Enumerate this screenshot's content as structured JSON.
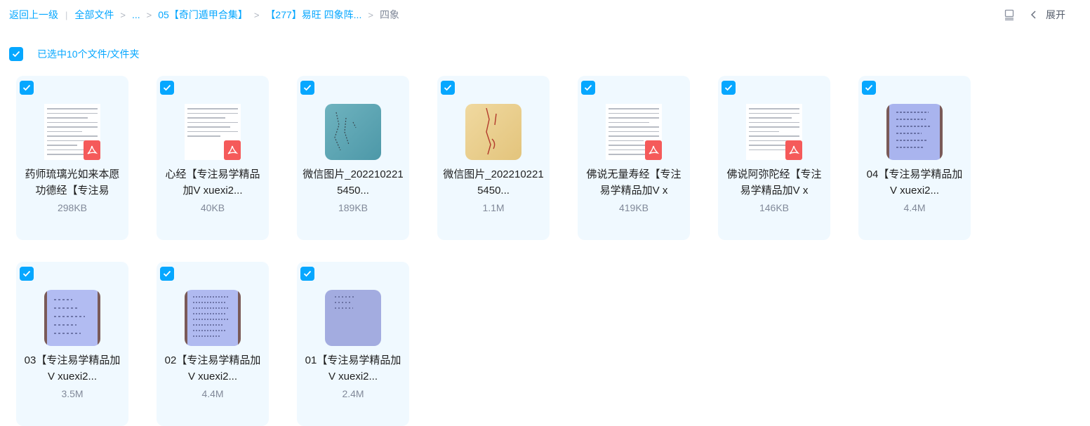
{
  "breadcrumb": {
    "back": "返回上一级",
    "all_files": "全部文件",
    "ellipsis": "...",
    "folder1": "05【奇门遁甲合集】",
    "folder2": "【277】易旺 四象阵...",
    "current": "四象",
    "arrow": ">"
  },
  "toolbar": {
    "expand_label": "展开"
  },
  "selection": {
    "label": "已选中10个文件/文件夹"
  },
  "files": [
    {
      "name": "药师琉璃光如来本愿功德经【专注易",
      "size": "298KB",
      "kind": "pdf"
    },
    {
      "name": "心经【专注易学精品加V xuexi2...",
      "size": "40KB",
      "kind": "pdf"
    },
    {
      "name": "微信图片_2022102215450...",
      "size": "189KB",
      "kind": "image"
    },
    {
      "name": "微信图片_2022102215450...",
      "size": "1.1M",
      "kind": "image"
    },
    {
      "name": "佛说无量寿经【专注易学精品加V x",
      "size": "419KB",
      "kind": "pdf"
    },
    {
      "name": "佛说阿弥陀经【专注易学精品加V x",
      "size": "146KB",
      "kind": "pdf"
    },
    {
      "name": "04【专注易学精品加V xuexi2...",
      "size": "4.4M",
      "kind": "image"
    },
    {
      "name": "03【专注易学精品加V xuexi2...",
      "size": "3.5M",
      "kind": "image"
    },
    {
      "name": "02【专注易学精品加V xuexi2...",
      "size": "4.4M",
      "kind": "image"
    },
    {
      "name": "01【专注易学精品加V xuexi2...",
      "size": "2.4M",
      "kind": "image"
    }
  ],
  "colors": {
    "accent": "#06a7ff",
    "card_bg": "#f0f9ff",
    "pdf_red": "#f55a5a"
  }
}
